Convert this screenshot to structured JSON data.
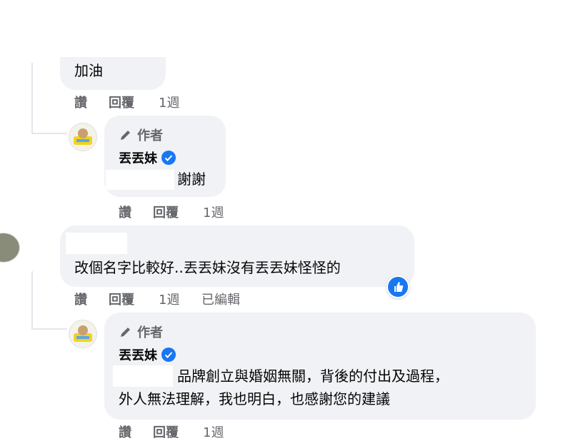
{
  "comments": [
    {
      "text": "加油",
      "actions": {
        "like": "讚",
        "reply": "回覆",
        "time": "1週"
      }
    },
    {
      "author_badge": "作者",
      "author_name": "丟丟妹",
      "text": "謝謝",
      "actions": {
        "like": "讚",
        "reply": "回覆",
        "time": "1週"
      }
    },
    {
      "text": "改個名字比較好..丟丟妹沒有丟丟妹怪怪的",
      "actions": {
        "like": "讚",
        "reply": "回覆",
        "time": "1週",
        "edited": "已編輯"
      },
      "reaction_icon": "like-icon"
    },
    {
      "author_badge": "作者",
      "author_name": "丟丟妹",
      "text_line1": "品牌創立與婚姻無關，背後的付出及過程，",
      "text_line2": "外人無法理解，我也明白，也感謝您的建議",
      "actions": {
        "like": "讚",
        "reply": "回覆",
        "time": "1週"
      }
    }
  ],
  "colors": {
    "accent": "#1877f2",
    "bubble": "#f0f2f5",
    "muted": "#65676b"
  }
}
